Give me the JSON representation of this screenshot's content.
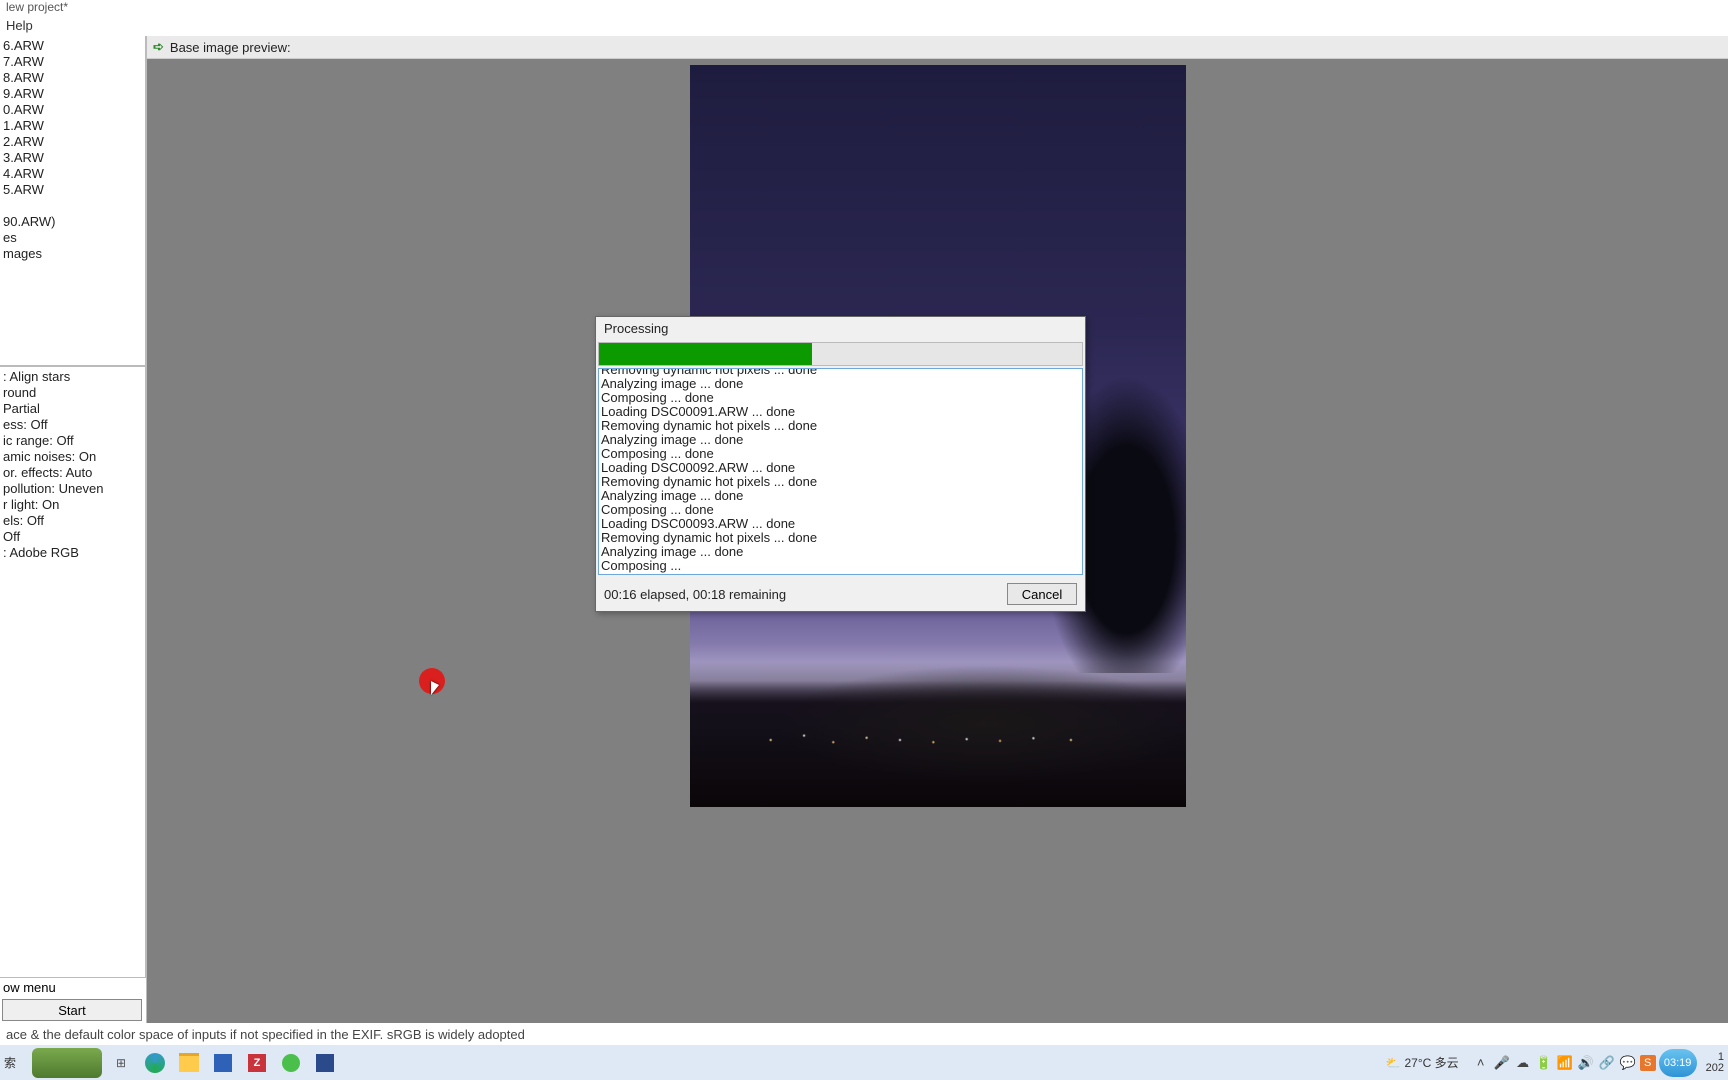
{
  "window": {
    "title": "lew project*"
  },
  "menubar": {
    "help": "Help"
  },
  "sidebar": {
    "files": [
      "6.ARW",
      "7.ARW",
      "8.ARW",
      "9.ARW",
      "0.ARW",
      "1.ARW",
      "2.ARW",
      "3.ARW",
      "4.ARW",
      "5.ARW"
    ],
    "extras": [
      "90.ARW)",
      "es",
      "mages"
    ],
    "settings": [
      ": Align stars",
      "round",
      "Partial",
      "ess: Off",
      "ic range: Off",
      "amic noises: On",
      "or. effects: Auto",
      " pollution: Uneven",
      "r light: On",
      "els: Off",
      "Off",
      ": Adobe RGB"
    ],
    "workflow_link": "ow menu",
    "start_label": "Start"
  },
  "preview": {
    "header": "Base image preview:"
  },
  "dialog": {
    "title": "Processing",
    "progress_percent": 44,
    "log": [
      "Removing dynamic hot pixels ... done",
      "Analyzing image ... done",
      "Composing ... done",
      "Loading DSC00091.ARW ... done",
      "Removing dynamic hot pixels ... done",
      "Analyzing image ... done",
      "Composing ... done",
      "Loading DSC00092.ARW ... done",
      "Removing dynamic hot pixels ... done",
      "Analyzing image ... done",
      "Composing ... done",
      "Loading DSC00093.ARW ... done",
      "Removing dynamic hot pixels ... done",
      "Analyzing image ... done",
      "Composing ... "
    ],
    "time_status": "00:16 elapsed, 00:18 remaining",
    "cancel_label": "Cancel"
  },
  "statusbar": {
    "text": "ace & the default color space of inputs if not specified in the EXIF. sRGB is widely adopted"
  },
  "taskbar": {
    "search_placeholder": "索",
    "weather": "27°C 多云",
    "clock_pill": "03:19",
    "time": "1",
    "date": "202"
  }
}
